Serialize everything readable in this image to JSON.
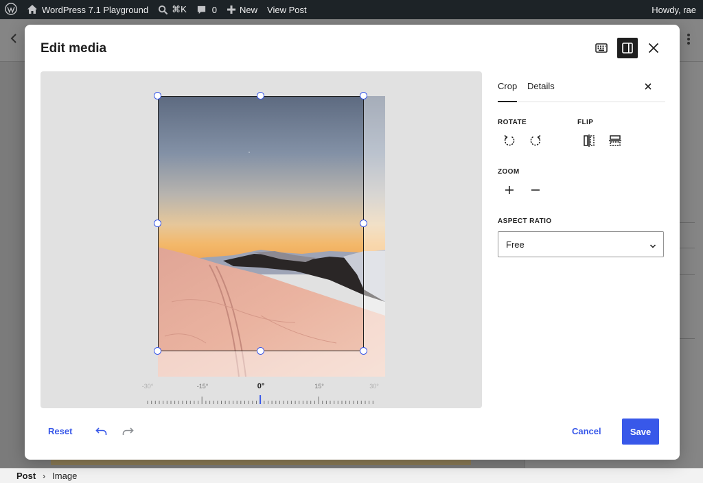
{
  "admin_bar": {
    "wp_logo": "wordpress-icon",
    "site_name": "WordPress 7.1 Playground",
    "search_shortcut": "⌘K",
    "comments_count": "0",
    "new_label": "New",
    "view_post_label": "View Post",
    "greeting": "Howdy, rae"
  },
  "breadcrumb": {
    "post": "Post",
    "separator": "›",
    "image": "Image"
  },
  "modal": {
    "title": "Edit media",
    "header_icons": [
      "keyboard-icon",
      "sidebar-toggle-icon",
      "close-icon"
    ]
  },
  "rotation_ruler": {
    "labels": [
      "-30°",
      "-15°",
      "0°",
      "15°",
      "30°"
    ],
    "current_angle": "0°"
  },
  "sidebar": {
    "tabs": [
      {
        "label": "Crop",
        "active": true
      },
      {
        "label": "Details",
        "active": false
      }
    ],
    "rotate_label": "ROTATE",
    "flip_label": "FLIP",
    "zoom_label": "ZOOM",
    "aspect_ratio_label": "ASPECT RATIO",
    "aspect_ratio_value": "Free",
    "rotate_icons": [
      "rotate-left-icon",
      "rotate-right-icon"
    ],
    "flip_icons": [
      "flip-horizontal-icon",
      "flip-vertical-icon"
    ],
    "zoom_icons": [
      "zoom-in-icon",
      "zoom-out-icon"
    ]
  },
  "footer": {
    "reset_label": "Reset",
    "cancel_label": "Cancel",
    "save_label": "Save"
  },
  "colors": {
    "accent": "#3858e9",
    "admin_bar": "#1d2327",
    "text": "#1e1e1e"
  }
}
